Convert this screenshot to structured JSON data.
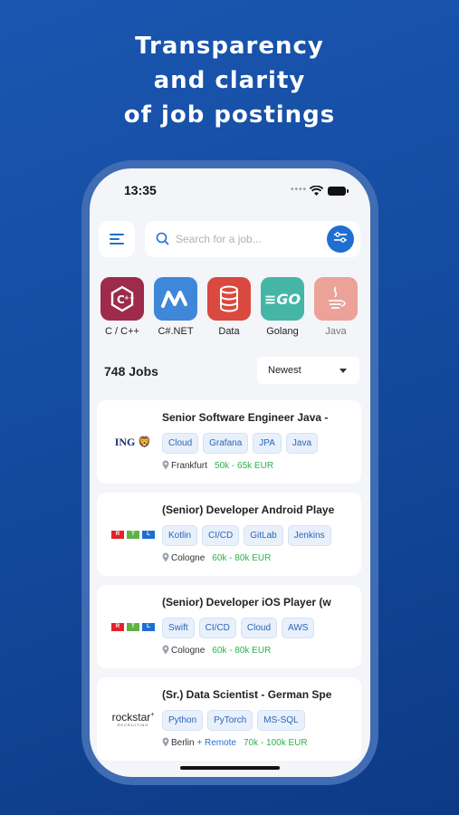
{
  "headline": [
    "Transparency",
    "and clarity",
    "of job postings"
  ],
  "status_bar": {
    "time": "13:35"
  },
  "search": {
    "placeholder": "Search for a job..."
  },
  "categories": [
    {
      "label": "C / C++",
      "color": "#9e2b4c",
      "icon": "c-plus-plus-icon"
    },
    {
      "label": "C#.NET",
      "color": "#3f87d9",
      "icon": "dotnet-icon"
    },
    {
      "label": "Data",
      "color": "#d9493f",
      "icon": "database-icon"
    },
    {
      "label": "Golang",
      "color": "#45b5a6",
      "icon": "golang-icon"
    },
    {
      "label": "Java",
      "color": "#e86b5a",
      "icon": "java-icon"
    }
  ],
  "jobs_count": "748 Jobs",
  "sort": {
    "selected": "Newest"
  },
  "jobs": [
    {
      "company": "ING",
      "title": "Senior Software Engineer Java - ",
      "tags": [
        "Cloud",
        "Grafana",
        "JPA",
        "Java"
      ],
      "city": "Frankfurt",
      "remote": "",
      "salary": "50k - 65k EUR"
    },
    {
      "company": "RTL",
      "title": "(Senior) Developer Android Playe",
      "tags": [
        "Kotlin",
        "CI/CD",
        "GitLab",
        "Jenkins"
      ],
      "city": "Cologne",
      "remote": "",
      "salary": "60k - 80k EUR"
    },
    {
      "company": "RTL",
      "title": "(Senior) Developer iOS Player (w",
      "tags": [
        "Swift",
        "CI/CD",
        "Cloud",
        "AWS"
      ],
      "city": "Cologne",
      "remote": "",
      "salary": "60k - 80k EUR"
    },
    {
      "company": "rockstar RECRUITING",
      "title": "(Sr.) Data Scientist - German Spe",
      "tags": [
        "Python",
        "PyTorch",
        "MS-SQL"
      ],
      "city": "Berlin",
      "remote": "+ Remote",
      "salary": "70k - 100k EUR"
    }
  ]
}
